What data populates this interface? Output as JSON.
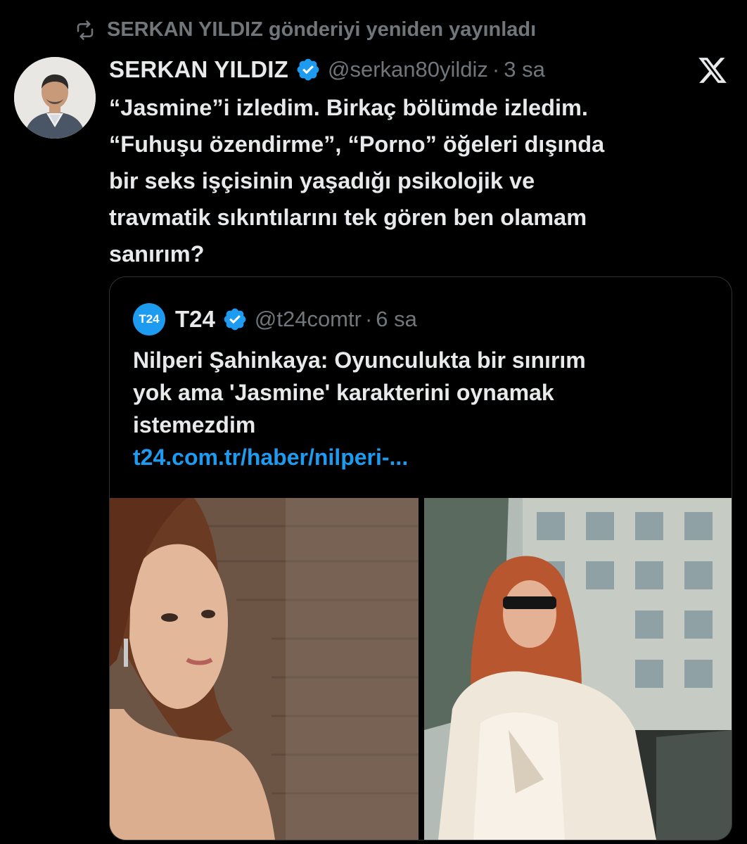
{
  "repost": {
    "text": "SERKAN YILDIZ gönderiyi yeniden yayınladı",
    "icon": "repost-icon"
  },
  "tweet": {
    "display_name": "SERKAN YILDIZ",
    "handle": "@serkan80yildiz",
    "separator": "·",
    "time": "3 sa",
    "verified_color": "#1d9bf0",
    "text_lines": [
      "“Jasmine”i izledim. Birkaç bölümde izledim.",
      "“Fuhuşu özendirme”, “Porno” öğeleri dışında",
      "bir seks işçisinin yaşadığı psikolojik ve",
      "travmatik sıkıntılarını tek gören ben olamam",
      "sanırım?"
    ]
  },
  "quote": {
    "avatar_text": "T24",
    "avatar_color": "#1d9bf0",
    "display_name": "T24",
    "handle": "@t24comtr",
    "separator": "·",
    "time": "6 sa",
    "text_lines": [
      "Nilperi Şahinkaya: Oyunculukta bir sınırım",
      "yok ama 'Jasmine' karakterini oynamak",
      "istemezdim"
    ],
    "link": "t24.com.tr/haber/nilperi-...",
    "link_color": "#1d9bf0"
  },
  "colors": {
    "background": "#000000",
    "text_primary": "#e7e9ea",
    "text_secondary": "#71767b",
    "border": "#2f3336"
  }
}
